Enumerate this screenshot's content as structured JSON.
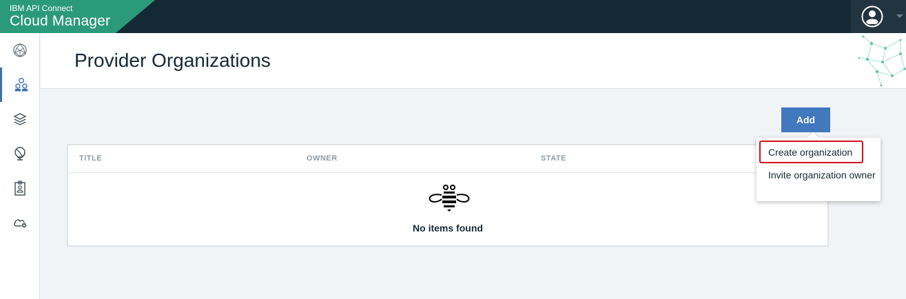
{
  "app": {
    "subtitle": "IBM API Connect",
    "title": "Cloud Manager"
  },
  "user": {
    "avatar_icon": "user-avatar-icon"
  },
  "sidebar": {
    "items": [
      {
        "icon": "dashboard-globe-icon",
        "active": false
      },
      {
        "icon": "organizations-icon",
        "active": true
      },
      {
        "icon": "resources-layers-icon",
        "active": false
      },
      {
        "icon": "topology-globe-icon",
        "active": false
      },
      {
        "icon": "members-badge-icon",
        "active": false
      },
      {
        "icon": "cloud-settings-icon",
        "active": false
      }
    ]
  },
  "page": {
    "title": "Provider Organizations"
  },
  "toolbar": {
    "add_label": "Add"
  },
  "table": {
    "columns": [
      "TITLE",
      "OWNER",
      "STATE"
    ],
    "rows": [],
    "empty_message": "No items found"
  },
  "add_menu": {
    "items": [
      {
        "label": "Create organization",
        "highlighted": true
      },
      {
        "label": "Invite organization owner",
        "highlighted": false
      }
    ]
  },
  "colors": {
    "topbar": "#152935",
    "brand": "#2b9a7a",
    "primary_button": "#4178be",
    "active_nav": "#3d70b2",
    "highlight_outline": "#d0101b"
  }
}
